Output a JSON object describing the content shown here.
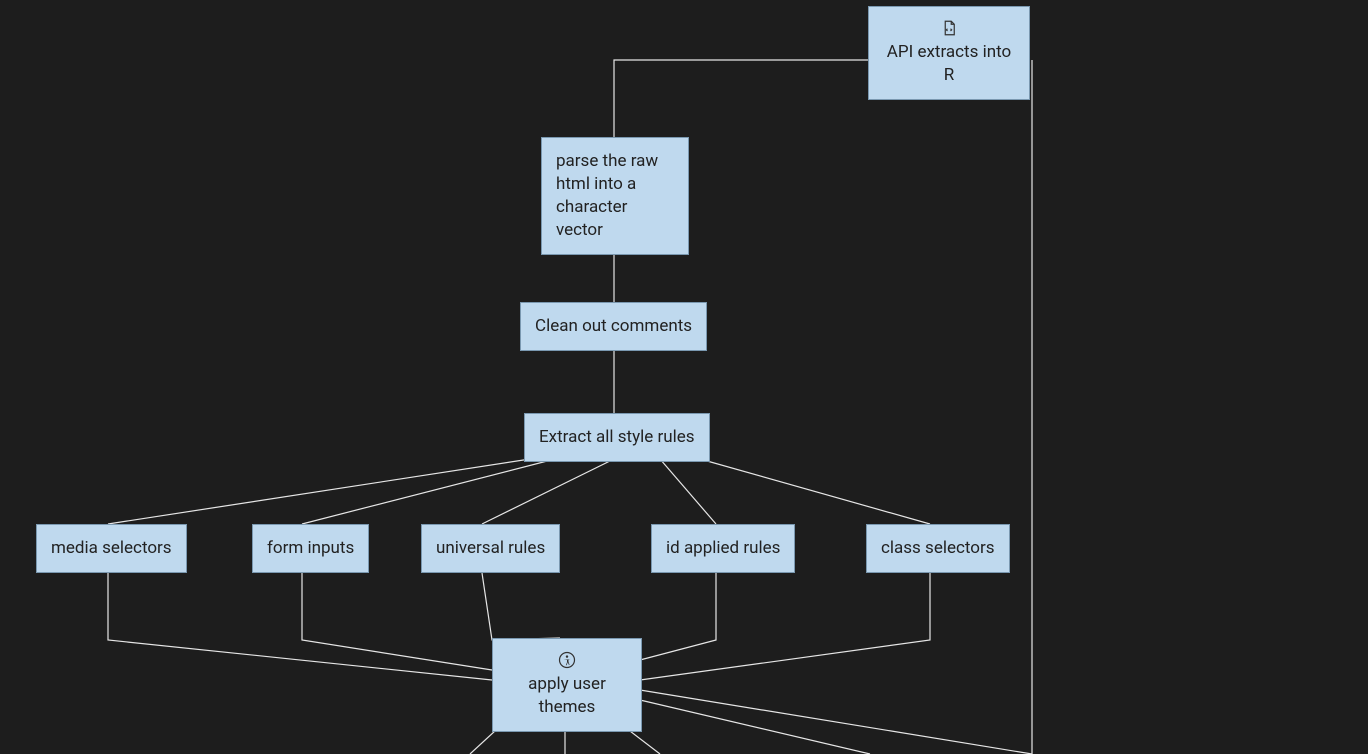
{
  "nodes": {
    "api": {
      "label": "API extracts into R",
      "icon": "code-file-icon"
    },
    "parse": {
      "label": "parse the raw html into a character vector"
    },
    "clean": {
      "label": "Clean out comments"
    },
    "extract": {
      "label": "Extract all style rules"
    },
    "media": {
      "label": "media selectors"
    },
    "form": {
      "label": "form inputs"
    },
    "universal": {
      "label": "universal rules"
    },
    "idrules": {
      "label": "id applied rules"
    },
    "classsel": {
      "label": "class selectors"
    },
    "apply": {
      "label": "apply user themes",
      "icon": "accessibility-icon"
    }
  },
  "colors": {
    "node_fill": "#bfd9ee",
    "node_border": "#7a98b0",
    "edge": "#e6e6e6",
    "background": "#1d1d1d"
  },
  "edges": [
    [
      "api",
      "parse"
    ],
    [
      "api",
      "apply_far"
    ],
    [
      "parse",
      "clean"
    ],
    [
      "clean",
      "extract"
    ],
    [
      "extract",
      "media"
    ],
    [
      "extract",
      "form"
    ],
    [
      "extract",
      "universal"
    ],
    [
      "extract",
      "idrules"
    ],
    [
      "extract",
      "classsel"
    ],
    [
      "media",
      "apply"
    ],
    [
      "form",
      "apply"
    ],
    [
      "universal",
      "apply"
    ],
    [
      "idrules",
      "apply"
    ],
    [
      "classsel",
      "apply"
    ]
  ]
}
